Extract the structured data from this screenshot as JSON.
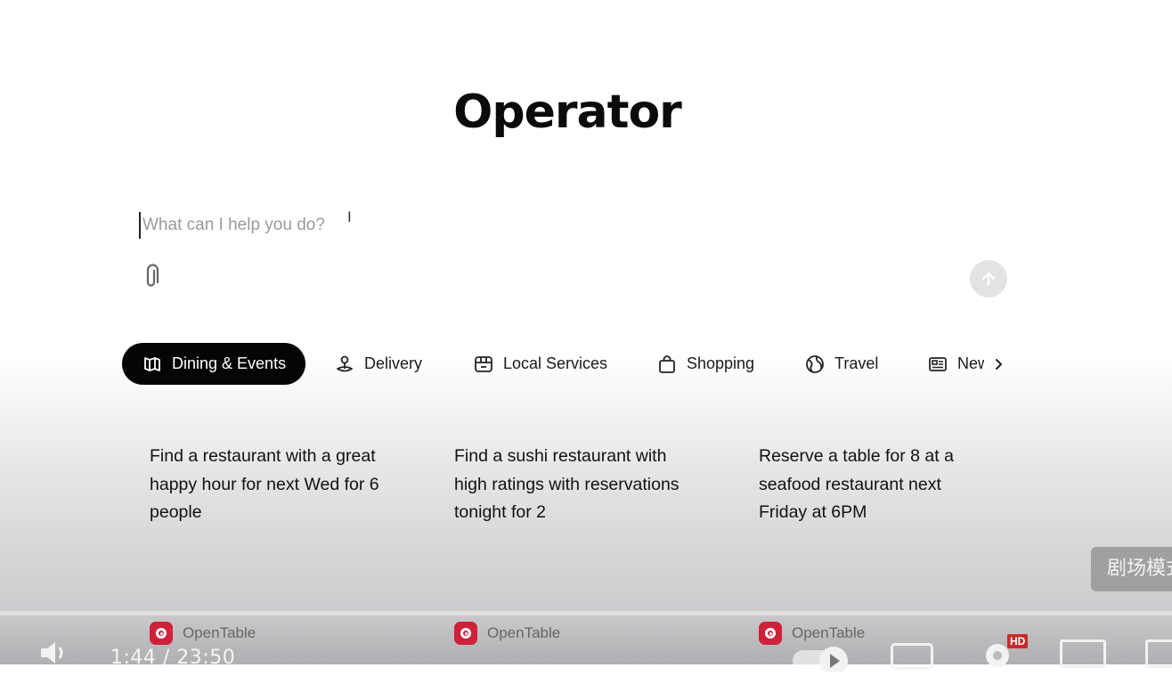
{
  "app": {
    "title": "Operator"
  },
  "prompt": {
    "placeholder": "What can I help you do?"
  },
  "tabs": [
    {
      "label": "Dining & Events",
      "icon": "dining-icon",
      "active": true
    },
    {
      "label": "Delivery",
      "icon": "delivery-pin-icon"
    },
    {
      "label": "Local Services",
      "icon": "store-icon"
    },
    {
      "label": "Shopping",
      "icon": "shopping-bag-icon"
    },
    {
      "label": "Travel",
      "icon": "globe-icon"
    },
    {
      "label": "News",
      "icon": "newspaper-icon"
    }
  ],
  "cards": [
    {
      "text": "Find a restaurant with a great happy hour for next Wed for 6 people",
      "source": "OpenTable"
    },
    {
      "text": "Find a sushi restaurant with high ratings with reservations tonight for 2",
      "source": "OpenTable"
    },
    {
      "text": "Reserve a table for 8 at a seafood restaurant next Friday at 6PM",
      "source": "OpenTable"
    }
  ],
  "overlay": {
    "theater_mode": "剧场模式"
  },
  "player": {
    "time": "1:44 / 23:50",
    "hd_badge": "HD",
    "progress": 0.073
  },
  "colors": {
    "accent": "#050505",
    "opentable": "#d0213a",
    "hd": "#cc2a2a"
  }
}
